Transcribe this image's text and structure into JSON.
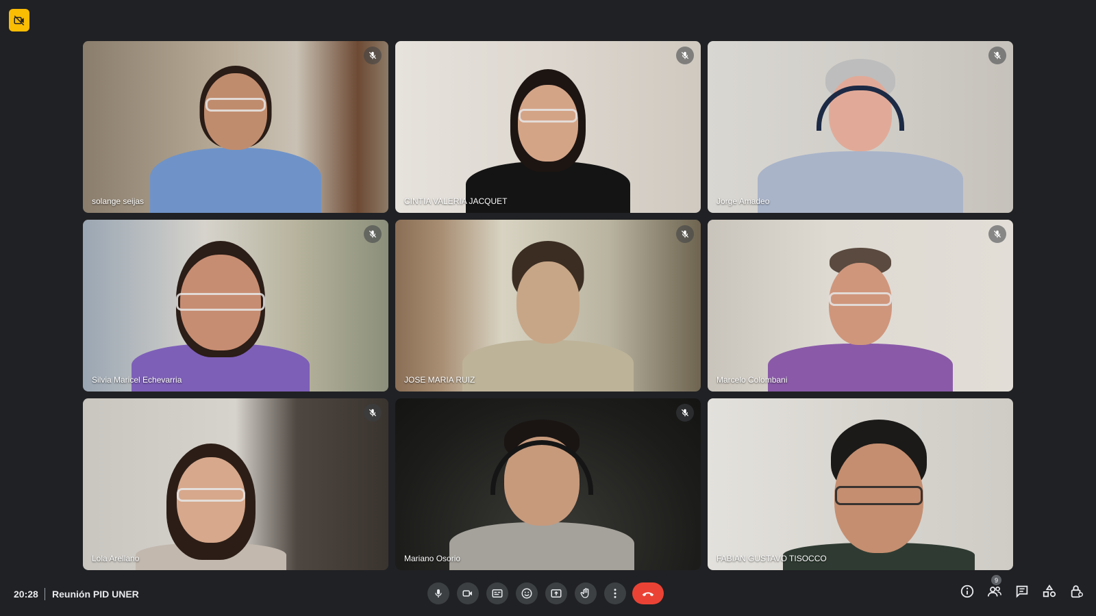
{
  "meeting": {
    "time": "20:28",
    "title": "Reunión PID UNER",
    "participant_count": "9"
  },
  "participants": [
    {
      "name": "solange seijas",
      "muted": true
    },
    {
      "name": "CINTIA VALERIA JACQUET",
      "muted": true
    },
    {
      "name": "Jorge Amadeo",
      "muted": true
    },
    {
      "name": "Silvia Maricel Echevarria",
      "muted": true
    },
    {
      "name": "JOSE MARIA RUIZ",
      "muted": true
    },
    {
      "name": "Marcelo Colombani",
      "muted": true
    },
    {
      "name": "Lola Arellano",
      "muted": true
    },
    {
      "name": "Mariano Osorio",
      "muted": true
    },
    {
      "name": "FABIAN GUSTAVO TISOCCO",
      "muted": false
    }
  ],
  "controls": [
    "microphone-icon",
    "camera-icon",
    "captions-icon",
    "emoji-icon",
    "present-icon",
    "raise-hand-icon",
    "more-options-icon",
    "end-call-icon"
  ],
  "right_controls": [
    "info-icon",
    "people-icon",
    "chat-icon",
    "activities-icon",
    "host-controls-icon"
  ],
  "colors": {
    "background": "#202124",
    "end_call": "#ea4335",
    "recording_badge": "#fbbc04",
    "control_button": "#3c4043"
  }
}
